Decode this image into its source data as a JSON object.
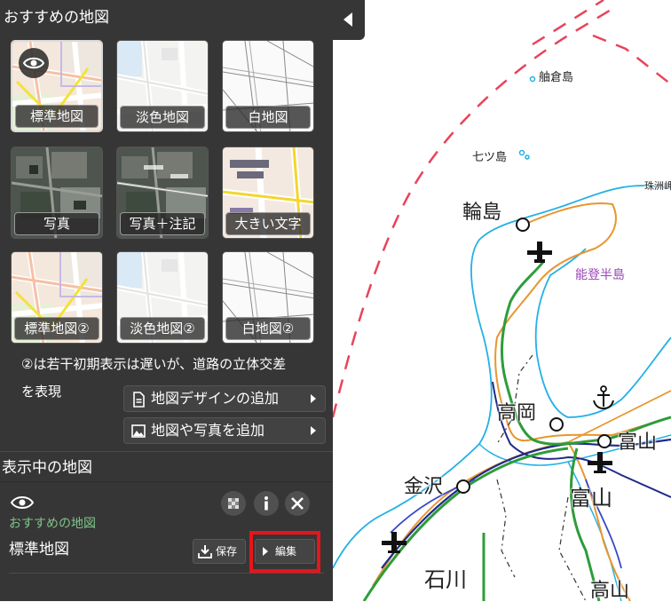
{
  "recommended": {
    "title": "おすすめの地図",
    "items": [
      {
        "label": "標準地図"
      },
      {
        "label": "淡色地図"
      },
      {
        "label": "白地図"
      },
      {
        "label": "写真"
      },
      {
        "label": "写真＋注記"
      },
      {
        "label": "大きい文字"
      },
      {
        "label": "標準地図②"
      },
      {
        "label": "淡色地図②"
      },
      {
        "label": "白地図②"
      }
    ],
    "note_line1": "②は若干初期表示は遅いが、道路の立体交差",
    "note_line2": "を表現",
    "add_design_label": "地図デザインの追加",
    "add_photo_label": "地図や写真を追加"
  },
  "displayed": {
    "title": "表示中の地図",
    "category": "おすすめの地図",
    "layer_name": "標準地図",
    "save_label": "保存",
    "edit_label": "編集"
  },
  "map_labels": {
    "hegura": "舳倉島",
    "nanatsu": "七ツ島",
    "suzu": "珠洲岬",
    "wajima": "輪島",
    "noto": "能登半島",
    "takaoka": "高岡",
    "toyama1": "富山",
    "toyama2": "富山",
    "kanazawa": "金沢",
    "ishikawa": "石川",
    "takayama": "高山"
  },
  "colors": {
    "panel_bg": "#363636",
    "highlight": "#e8141b",
    "boundary": "#e8435a",
    "coast": "#23b0e6",
    "highway": "#2e9c3a",
    "national_road": "#e8962e",
    "rail": "#1f2a8a",
    "noto_label": "#9b45b5"
  },
  "icons": [
    "eye-icon",
    "document-icon",
    "image-icon",
    "chevron-right-icon",
    "checker-icon",
    "info-icon",
    "close-icon",
    "download-icon",
    "chevron-left-icon",
    "airport-icon",
    "port-icon"
  ]
}
